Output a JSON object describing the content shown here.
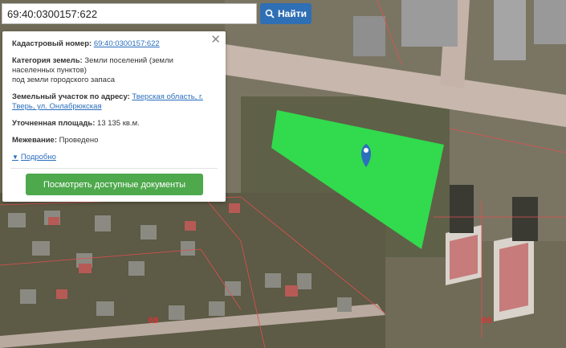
{
  "search": {
    "value": "69:40:0300157:622",
    "button_label": "Найти"
  },
  "popup": {
    "cadastral_label": "Кадастровый номер:",
    "cadastral_value": "69:40:0300157:622",
    "category_label": "Категория земель:",
    "category_value": "Земли поселений (земли населенных пунктов)",
    "category_value_2": "под земли городского запаса",
    "address_label": "Земельный участок по адресу:",
    "address_value": "Тверская область, г. Тверь, ул. Онлабрюкская",
    "area_label": "Уточненная площадь:",
    "area_value": "13 135 кв.м.",
    "survey_label": "Межевание:",
    "survey_value": "Проведено",
    "more_label": "Подробно",
    "docs_button": "Посмотреть доступные документы"
  },
  "map": {
    "district_labels": [
      "69",
      "69"
    ],
    "parcel_color": "#2ee84e",
    "marker_color": "#2d6fbd"
  }
}
